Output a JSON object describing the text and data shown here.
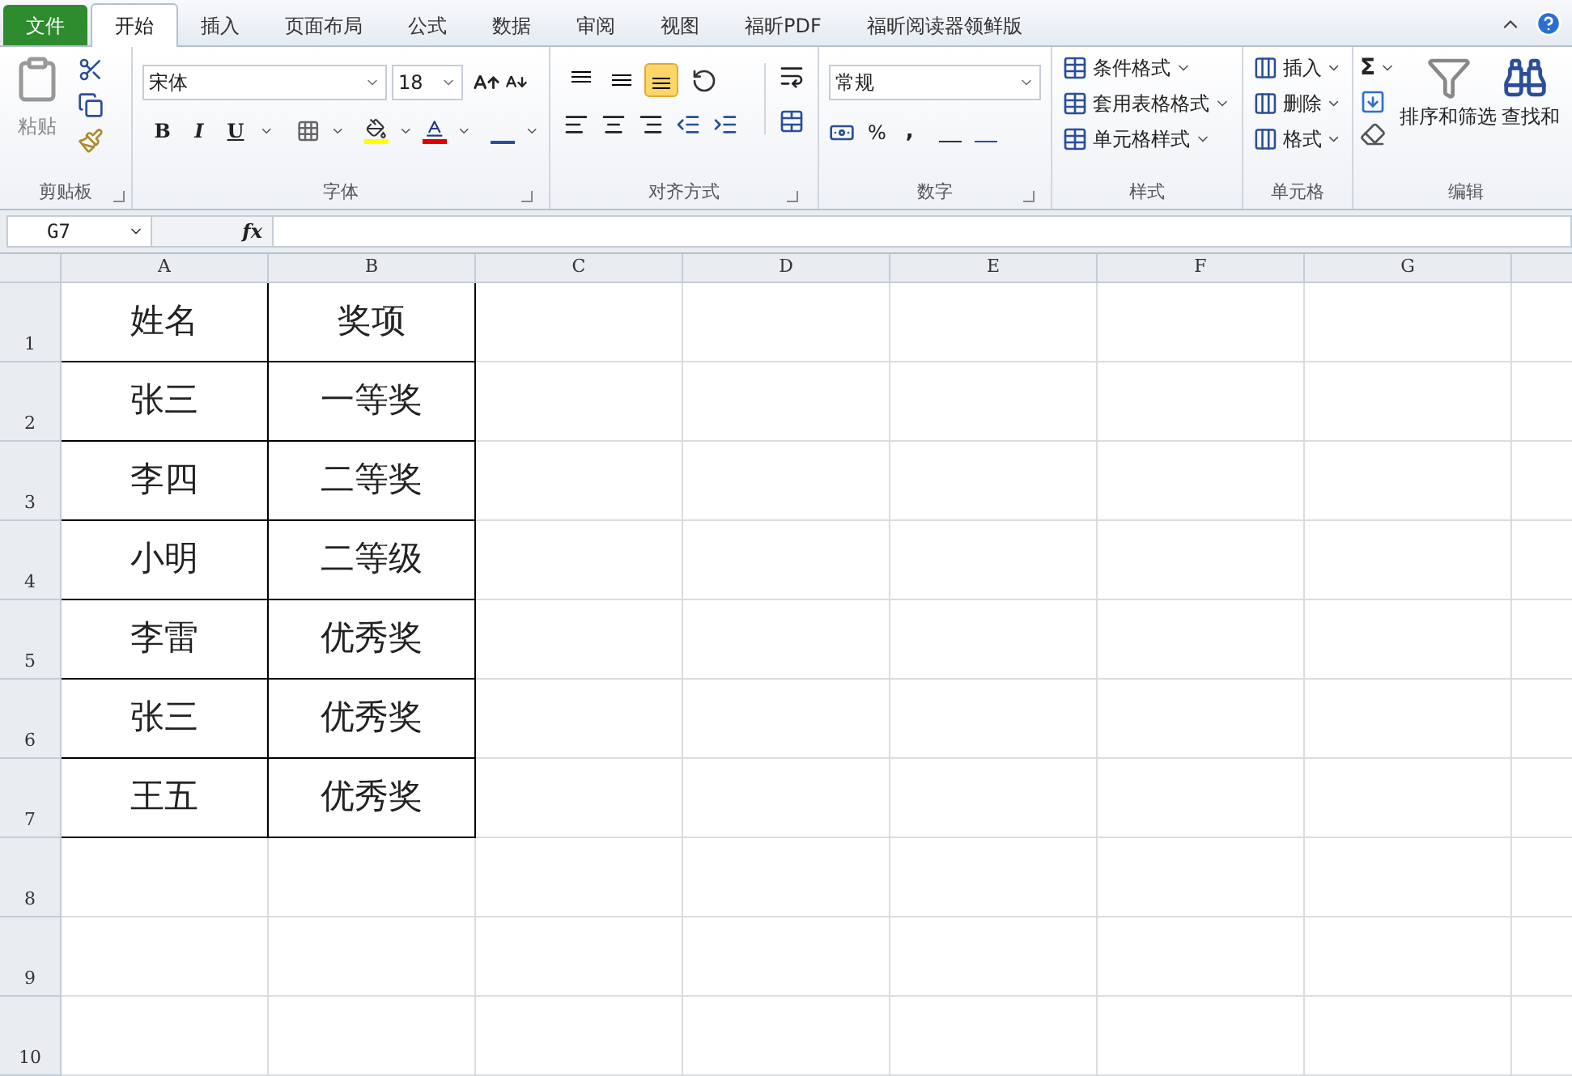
{
  "tabs": [
    {
      "label": "文件",
      "kind": "file",
      "selected": false
    },
    {
      "label": "开始",
      "kind": "tab",
      "selected": true
    },
    {
      "label": "插入",
      "kind": "tab",
      "selected": false
    },
    {
      "label": "页面布局",
      "kind": "tab",
      "selected": false
    },
    {
      "label": "公式",
      "kind": "tab",
      "selected": false
    },
    {
      "label": "数据",
      "kind": "tab",
      "selected": false
    },
    {
      "label": "审阅",
      "kind": "tab",
      "selected": false
    },
    {
      "label": "视图",
      "kind": "tab",
      "selected": false
    },
    {
      "label": "福昕PDF",
      "kind": "tab",
      "selected": false
    },
    {
      "label": "福昕阅读器领鲜版",
      "kind": "tab",
      "selected": false
    }
  ],
  "clipboard": {
    "paste": "粘贴",
    "label": "剪贴板"
  },
  "font": {
    "name": "宋体",
    "size": "18",
    "bold": "B",
    "italic": "I",
    "underline": "U",
    "label": "字体"
  },
  "alignment": {
    "vertical": [
      {
        "kind": "top",
        "selected": false
      },
      {
        "kind": "middle",
        "selected": false
      },
      {
        "kind": "bottom",
        "selected": true
      }
    ],
    "label": "对齐方式"
  },
  "number": {
    "format": "常规",
    "percent": "%",
    "comma": ",",
    "label": "数字"
  },
  "styles": {
    "items": [
      "条件格式",
      "套用表格格式",
      "单元格样式"
    ],
    "label": "样式"
  },
  "cells": {
    "items": [
      "插入",
      "删除",
      "格式"
    ],
    "label": "单元格"
  },
  "editing": {
    "sum": "Σ",
    "sort": "排序和筛选",
    "find": "查找和",
    "label": "编辑"
  },
  "formula_bar": {
    "name_box": "G7",
    "function_label": "fx"
  },
  "sheet": {
    "columns": [
      "A",
      "B",
      "C",
      "D",
      "E",
      "F",
      "G"
    ],
    "rows": [
      {
        "number": "1",
        "cells": [
          "姓名",
          "奖项"
        ]
      },
      {
        "number": "2",
        "cells": [
          "张三",
          "一等奖"
        ]
      },
      {
        "number": "3",
        "cells": [
          "李四",
          "二等奖"
        ]
      },
      {
        "number": "4",
        "cells": [
          "小明",
          "二等级"
        ]
      },
      {
        "number": "5",
        "cells": [
          "李雷",
          "优秀奖"
        ]
      },
      {
        "number": "6",
        "cells": [
          "张三",
          "优秀奖"
        ]
      },
      {
        "number": "7",
        "cells": [
          "王五",
          "优秀奖"
        ]
      },
      {
        "number": "8",
        "cells": []
      },
      {
        "number": "9",
        "cells": []
      },
      {
        "number": "10",
        "cells": []
      }
    ]
  }
}
